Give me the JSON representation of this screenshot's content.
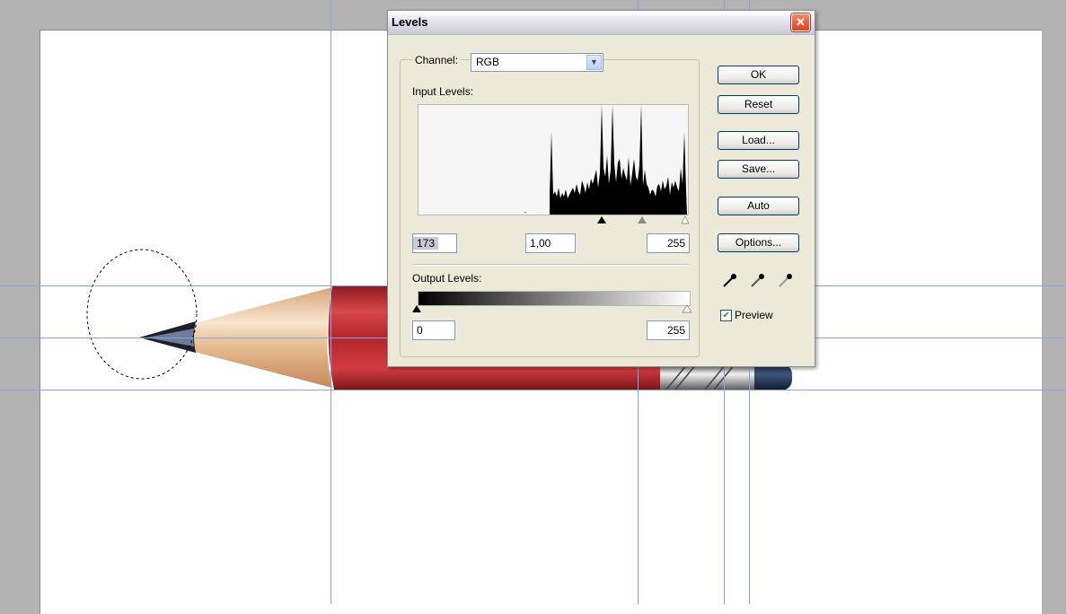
{
  "dialog": {
    "title": "Levels",
    "close_glyph": "✕",
    "channel_label": "Channel:",
    "channel_value": "RGB",
    "input_levels_label": "Input Levels:",
    "input_black": "173",
    "input_gamma": "1,00",
    "input_white": "255",
    "output_levels_label": "Output Levels:",
    "output_black": "0",
    "output_white": "255",
    "buttons": {
      "ok": "OK",
      "reset": "Reset",
      "load": "Load...",
      "save": "Save...",
      "auto": "Auto",
      "options": "Options..."
    },
    "preview_label": "Preview",
    "preview_checked": true
  },
  "icons": {
    "close": "close-icon",
    "dropdown": "chevron-down-icon",
    "eyedroppers": [
      "black-eyedropper-icon",
      "gray-eyedropper-icon",
      "white-eyedropper-icon"
    ]
  },
  "colors": {
    "pencil_body": "#b3262b",
    "pencil_wood": "#e8c29c",
    "guide": "#7fa6e6"
  }
}
